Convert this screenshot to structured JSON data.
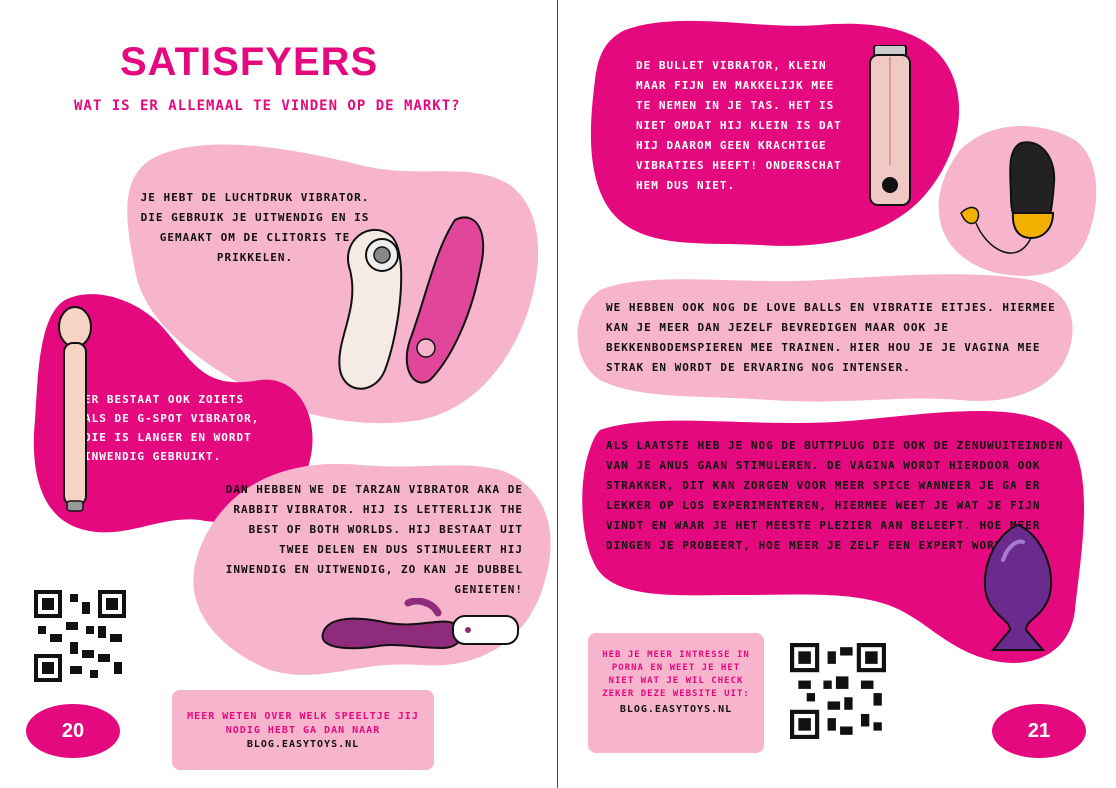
{
  "left": {
    "title": "SATISFYERS",
    "subtitle": "WAT IS ER ALLEMAAL TE VINDEN OP DE MARKT?",
    "air_pulse_text": "JE HEBT DE LUCHTDRUK VIBRATOR. DIE GEBRUIK JE UITWENDIG EN IS GEMAAKT OM DE CLITORIS TE PRIKKELEN.",
    "gspot_text": "ER BESTAAT OOK ZOIETS ALS DE G-SPOT VIBRATOR, DIE IS LANGER EN WORDT INWENDIG GEBRUIKT.",
    "rabbit_text": "DAN HEBBEN WE DE TARZAN VIBRATOR AKA DE RABBIT VIBRATOR. HIJ IS LETTERLIJK THE BEST OF BOTH WORLDS. HIJ BESTAAT UIT TWEE DELEN EN DUS STIMULEERT HIJ INWENDIG EN UITWENDIG, ZO KAN JE DUBBEL GENIETEN!",
    "info_text": "MEER WETEN OVER WELK SPEELTJE JIJ NODIG HEBT GA DAN NAAR",
    "info_link": "BLOG.EASYTOYS.NL",
    "page_number": "20"
  },
  "right": {
    "bullet_text": "DE BULLET VIBRATOR, KLEIN MAAR FIJN EN MAKKELIJK MEE TE NEMEN IN JE TAS. HET IS NIET OMDAT HIJ KLEIN IS DAT HIJ DAAROM GEEN KRACHTIGE VIBRATIES HEEFT! ONDERSCHAT HEM DUS NIET.",
    "loveballs_text": "WE HEBBEN OOK NOG DE LOVE BALLS EN VIBRATIE EITJES. HIERMEE KAN JE MEER DAN JEZELF BEVREDIGEN MAAR OOK JE BEKKENBODEMSPIEREN MEE TRAINEN. HIER HOU JE JE VAGINA MEE STRAK EN WORDT DE ERVARING NOG INTENSER.",
    "buttplug_text": "ALS LAATSTE HEB JE NOG DE BUTTPLUG DIE OOK DE ZENUWUITEINDEN VAN JE ANUS GAAN STIMULEREN. DE VAGINA WORDT HIERDOOR OOK STRAKKER, DIT KAN ZORGEN VOOR MEER SPICE WANNEER JE GA ER LEKKER OP LOS EXPERIMENTEREN, HIERMEE WEET JE WAT JE FIJN VINDT EN WAAR JE HET MEESTE PLEZIER AAN BELEEFT. HOE MEER DINGEN JE PROBEERT, HOE MEER JE ZELF EEN EXPERT WORDT.",
    "info_text": "HEB JE MEER INTRESSE IN PORNA EN WEET JE HET NIET WAT JE WIL CHECK ZEKER DEZE WEBSITE UIT:",
    "info_link": "BLOG.EASYTOYS.NL",
    "page_number": "21"
  },
  "colors": {
    "magenta": "#e5097f",
    "pink": "#f7b4cd",
    "text": "#111111"
  },
  "icons": [
    "qr-code-icon",
    "air-pulse-vibrator-icon",
    "gspot-vibrator-icon",
    "rabbit-vibrator-icon",
    "bullet-vibrator-icon",
    "vibrating-egg-icon",
    "buttplug-icon"
  ]
}
